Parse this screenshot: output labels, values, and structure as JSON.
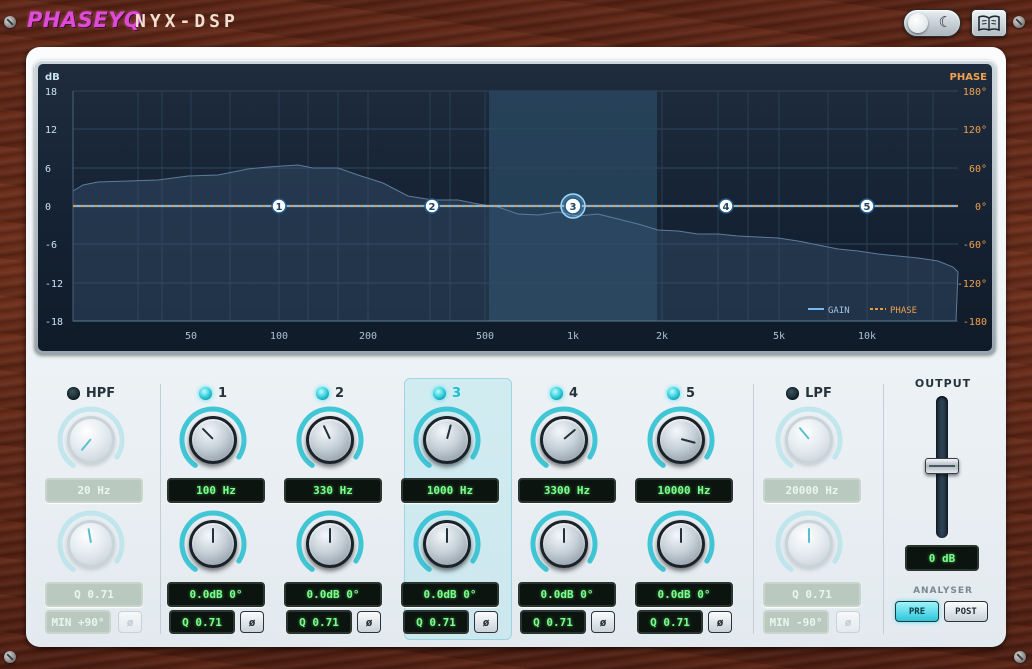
{
  "app": {
    "brand": "PHASEYQ",
    "product": "NYX-DSP",
    "theme_toggle_icon": "moon-icon",
    "manual_icon": "book-icon"
  },
  "graph": {
    "left_axis_title": "dB",
    "right_axis_title": "PHASE",
    "db_ticks": [
      "18",
      "12",
      "6",
      "0",
      "-6",
      "-12",
      "-18"
    ],
    "phase_ticks": [
      "180°",
      "120°",
      "60°",
      "0°",
      "-60°",
      "-120°",
      "-180"
    ],
    "freq_ticks": [
      "50",
      "100",
      "200",
      "500",
      "1k",
      "2k",
      "5k",
      "10k"
    ],
    "legend_gain": "GAIN",
    "legend_phase": "PHASE",
    "colors": {
      "gain": "#78b8ef",
      "phase": "#e59a3c",
      "node": "#ffffff",
      "highlight": "#2a4a63"
    },
    "nodes": [
      "1",
      "2",
      "3",
      "4",
      "5"
    ],
    "selected_node": "3"
  },
  "bands": [
    {
      "id": "hpf",
      "label": "HPF",
      "enabled": false,
      "freq": "20 Hz",
      "q": "Q 0.71",
      "mode": "MIN +90°",
      "phase_btn": "ø"
    },
    {
      "id": "1",
      "label": "1",
      "enabled": true,
      "freq": "100 Hz",
      "gain_phase": "0.0dB 0°",
      "q": "Q 0.71",
      "phase_btn": "ø"
    },
    {
      "id": "2",
      "label": "2",
      "enabled": true,
      "freq": "330 Hz",
      "gain_phase": "0.0dB 0°",
      "q": "Q 0.71",
      "phase_btn": "ø"
    },
    {
      "id": "3",
      "label": "3",
      "enabled": true,
      "freq": "1000 Hz",
      "gain_phase": "0.0dB 0°",
      "q": "Q 0.71",
      "phase_btn": "ø",
      "selected": true
    },
    {
      "id": "4",
      "label": "4",
      "enabled": true,
      "freq": "3300 Hz",
      "gain_phase": "0.0dB 0°",
      "q": "Q 0.71",
      "phase_btn": "ø"
    },
    {
      "id": "5",
      "label": "5",
      "enabled": true,
      "freq": "10000 Hz",
      "gain_phase": "0.0dB 0°",
      "q": "Q 0.71",
      "phase_btn": "ø"
    },
    {
      "id": "lpf",
      "label": "LPF",
      "enabled": false,
      "freq": "20000 Hz",
      "q": "Q 0.71",
      "mode": "MIN -90°",
      "phase_btn": "ø"
    }
  ],
  "output": {
    "label": "OUTPUT",
    "value": "0 dB",
    "analyser_label": "ANALYSER",
    "pre_label": "PRE",
    "post_label": "POST",
    "analyser_mode": "PRE"
  }
}
